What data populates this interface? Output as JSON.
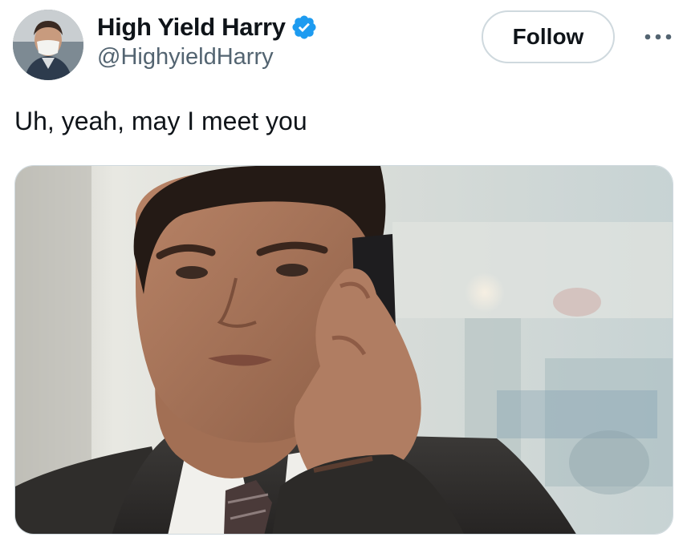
{
  "author": {
    "display_name": "High Yield Harry",
    "handle": "@HighyieldHarry",
    "verified": true,
    "verified_color": "#1d9bf0"
  },
  "actions": {
    "follow_label": "Follow",
    "more_icon": "more-horizontal-icon"
  },
  "tweet": {
    "text": "Uh, yeah, may I meet you"
  },
  "media": {
    "type": "image",
    "subject": "man in suit talking on phone"
  }
}
